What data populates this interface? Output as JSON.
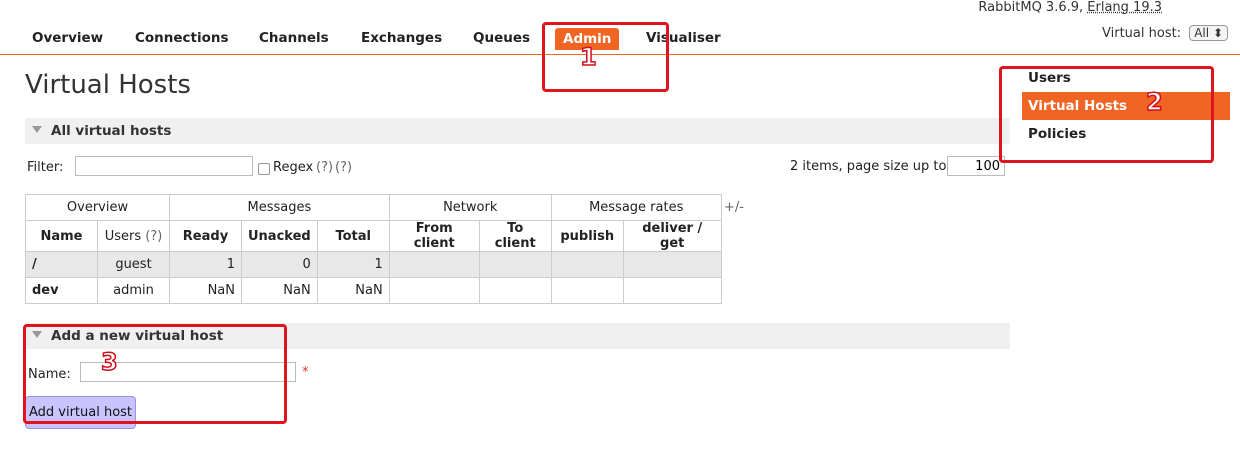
{
  "top_info": {
    "version": "RabbitMQ 3.6.9,",
    "erlang": "Erlang 19.3"
  },
  "nav": {
    "items": [
      "Overview",
      "Connections",
      "Channels",
      "Exchanges",
      "Queues",
      "Admin",
      "Visualiser"
    ],
    "active": "Admin"
  },
  "vhost_selector": {
    "label": "Virtual host:",
    "value": "All",
    "arrow": "⬍"
  },
  "page_title": "Virtual Hosts",
  "all_section": {
    "title": "All virtual hosts"
  },
  "filter": {
    "label": "Filter:",
    "value": "",
    "regex_label": "Regex",
    "help1": "(?)",
    "help2": "(?)",
    "paging": "2 items, page size up to",
    "page_size": "100"
  },
  "table": {
    "groups": [
      "Overview",
      "Messages",
      "Network",
      "Message rates"
    ],
    "plus_minus": "+/-",
    "headers": [
      "Name",
      "Users",
      "Ready",
      "Unacked",
      "Total",
      "From client",
      "To client",
      "publish",
      "deliver / get"
    ],
    "users_help": "(?)",
    "rows": [
      {
        "name": "/",
        "users": "guest",
        "ready": "1",
        "unacked": "0",
        "total": "1"
      },
      {
        "name": "dev",
        "users": "admin",
        "ready": "NaN",
        "unacked": "NaN",
        "total": "NaN"
      }
    ]
  },
  "add_section": {
    "title": "Add a new virtual host",
    "name_label": "Name:",
    "required": "*",
    "button": "Add virtual host"
  },
  "sidebar": {
    "items": [
      "Users",
      "Virtual Hosts",
      "Policies"
    ],
    "active": "Virtual Hosts"
  },
  "annotations": {
    "one": "1",
    "two": "2",
    "three": "3",
    "color": "#e0141e"
  },
  "colors": {
    "accent": "#f06424",
    "button": "#c9c3ff"
  }
}
